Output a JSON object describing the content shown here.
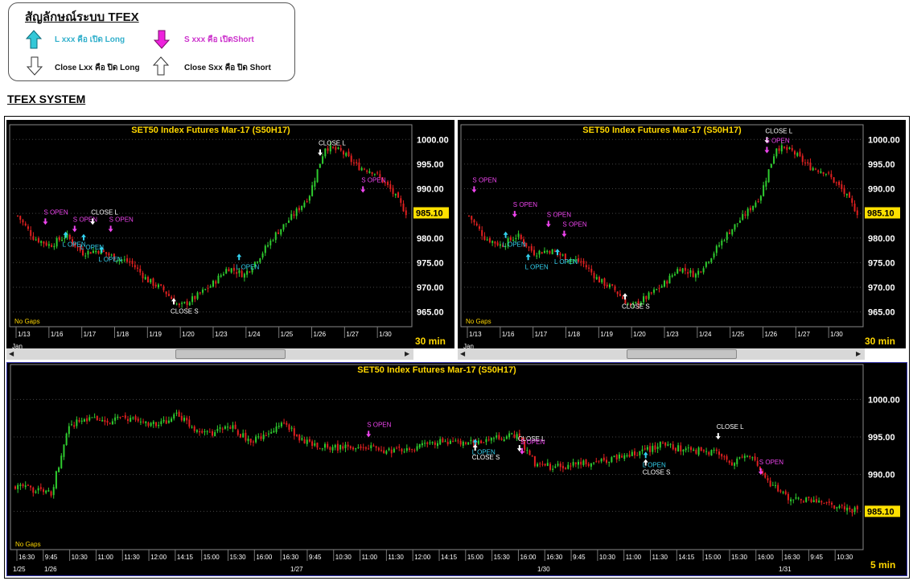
{
  "legend": {
    "title": "สัญลักษณ์ระบบ TFEX",
    "items": [
      {
        "label": "L xxx คือ เปิด Long",
        "color": "#33b0cc"
      },
      {
        "label": "S xxx คือ เปิดShort",
        "color": "#cc33cc"
      },
      {
        "label": "Close Lxx คือ ปิด Long",
        "color": "#111111"
      },
      {
        "label": "Close Sxx คือ ปิด Short",
        "color": "#111111"
      }
    ]
  },
  "system_title": "TFEX SYSTEM",
  "colors": {
    "up": "#2fcc2f",
    "down": "#e02020",
    "long": "#33d0ee",
    "short": "#ee44ee",
    "close": "#ffffff",
    "title": "#ffd700",
    "price_bg": "#ffe000"
  },
  "panels": [
    {
      "title": "SET50  Index  Futures  Mar-17  (S50H17)",
      "timeframe": "30  min",
      "no_gaps": "No  Gaps",
      "price_tag": "985.10",
      "y_ticks": [
        "1000.00",
        "995.00",
        "990.00",
        "985.00",
        "980.00",
        "975.00",
        "970.00",
        "965.00"
      ],
      "x_ticks": [
        "1/13",
        "1/16",
        "1/17",
        "1/18",
        "1/19",
        "1/20",
        "1/23",
        "1/24",
        "1/25",
        "1/26",
        "1/27",
        "1/30"
      ],
      "month_label": "Jan"
    },
    {
      "title": "SET50  Index  Futures  Mar-17  (S50H17)",
      "timeframe": "30  min",
      "no_gaps": "No  Gaps",
      "price_tag": "985.10",
      "y_ticks": [
        "1000.00",
        "995.00",
        "990.00",
        "985.00",
        "980.00",
        "975.00",
        "970.00",
        "965.00"
      ],
      "x_ticks": [
        "1/13",
        "1/16",
        "1/17",
        "1/18",
        "1/19",
        "1/20",
        "1/23",
        "1/24",
        "1/25",
        "1/26",
        "1/27",
        "1/30"
      ],
      "month_label": "Jan"
    },
    {
      "title": "SET50  Index  Futures  Mar-17  (S50H17)",
      "timeframe": "5  min",
      "no_gaps": "No  Gaps",
      "price_tag": "985.10",
      "y_ticks": [
        "1000.00",
        "995.00",
        "990.00",
        "985.10"
      ],
      "x_ticks": [
        "16:30",
        "9:45",
        "10:30",
        "11:00",
        "11:30",
        "12:00",
        "14:15",
        "15:00",
        "15:30",
        "16:00",
        "16:30",
        "9:45",
        "10:30",
        "11:00",
        "11:30",
        "12:00",
        "14:15",
        "15:00",
        "15:30",
        "16:00",
        "16:30",
        "9:45",
        "10:30",
        "11:00",
        "11:30",
        "14:15",
        "15:00",
        "15:30",
        "16:00",
        "16:30",
        "9:45",
        "10:30"
      ],
      "date_labels": [
        "1/25",
        "1/26",
        "1/27",
        "1/30",
        "1/31"
      ]
    }
  ],
  "chart_data": [
    {
      "type": "candlestick",
      "title": "SET50  Index  Futures  Mar-17  (S50H17)",
      "timeframe": "30 min",
      "ylim": [
        962,
        1002
      ],
      "dates": [
        "1/13",
        "1/16",
        "1/17",
        "1/18",
        "1/19",
        "1/20",
        "1/23",
        "1/24",
        "1/25",
        "1/26",
        "1/27",
        "1/30"
      ],
      "closes": [
        984.5,
        980,
        978.5,
        980.5,
        977,
        977.5,
        976,
        975,
        971.5,
        969.5,
        966,
        968,
        970.5,
        974,
        972.5,
        976.5,
        981,
        984.5,
        988.5,
        998.5,
        997.5,
        994.5,
        993.5,
        990,
        985.2
      ],
      "signals": [
        {
          "label": "S  OPEN",
          "kind": "short",
          "x": 1.3,
          "y": 983.5
        },
        {
          "label": "L  OPEN",
          "kind": "long",
          "x": 2.2,
          "y": 980.5
        },
        {
          "label": "S  OPEN",
          "kind": "short",
          "x": 2.6,
          "y": 982
        },
        {
          "label": "L  OPEN",
          "kind": "long",
          "x": 3.0,
          "y": 980
        },
        {
          "label": "CLOSE  L",
          "kind": "close",
          "x": 3.4,
          "y": 983.5
        },
        {
          "label": "L  OPEN",
          "kind": "long",
          "x": 3.8,
          "y": 977.5
        },
        {
          "label": "S  OPEN",
          "kind": "short",
          "x": 4.2,
          "y": 982
        },
        {
          "label": "CLOSE  S",
          "kind": "close",
          "x": 7.0,
          "y": 967
        },
        {
          "label": "L  OPEN",
          "kind": "long",
          "x": 9.9,
          "y": 976
        },
        {
          "label": "CLOSE  L",
          "kind": "close",
          "x": 13.5,
          "y": 997.5
        },
        {
          "label": "S  OPEN",
          "kind": "short",
          "x": 15.4,
          "y": 990
        }
      ],
      "last_price": 985.1
    },
    {
      "type": "candlestick",
      "title": "SET50  Index  Futures  Mar-17  (S50H17)",
      "timeframe": "30 min",
      "ylim": [
        962,
        1002
      ],
      "dates": [
        "1/13",
        "1/16",
        "1/17",
        "1/18",
        "1/19",
        "1/20",
        "1/23",
        "1/24",
        "1/25",
        "1/26",
        "1/27",
        "1/30"
      ],
      "closes": [
        984.5,
        980,
        978.5,
        980.5,
        977,
        977.5,
        976,
        975,
        971.5,
        969.5,
        966,
        968,
        970.5,
        974,
        972.5,
        976.5,
        981,
        984.5,
        988.5,
        998.5,
        997.5,
        994.5,
        993.5,
        990,
        985.2
      ],
      "signals": [
        {
          "label": "S  OPEN",
          "kind": "short",
          "x": 0.3,
          "y": 990
        },
        {
          "label": "L  OPEN",
          "kind": "long",
          "x": 1.7,
          "y": 980.5
        },
        {
          "label": "S  OPEN",
          "kind": "short",
          "x": 2.1,
          "y": 985
        },
        {
          "label": "L  OPEN",
          "kind": "long",
          "x": 2.7,
          "y": 976
        },
        {
          "label": "S  OPEN",
          "kind": "short",
          "x": 3.6,
          "y": 983
        },
        {
          "label": "L  OPEN",
          "kind": "long",
          "x": 4.0,
          "y": 977
        },
        {
          "label": "S  OPEN",
          "kind": "short",
          "x": 4.3,
          "y": 981
        },
        {
          "label": "CLOSE  S",
          "kind": "close",
          "x": 7.0,
          "y": 968
        },
        {
          "label": "CLOSE  L",
          "kind": "close",
          "x": 13.3,
          "y": 1000
        },
        {
          "label": "S  OPEN",
          "kind": "short",
          "x": 13.3,
          "y": 998
        }
      ],
      "last_price": 985.1
    },
    {
      "type": "candlestick",
      "title": "SET50  Index  Futures  Mar-17  (S50H17)",
      "timeframe": "5 min",
      "ylim": [
        980,
        1004
      ],
      "dates": [
        "1/25",
        "1/26",
        "1/27",
        "1/30",
        "1/31"
      ],
      "signals": [
        {
          "label": "S  OPEN",
          "kind": "short",
          "x": 0.42,
          "y": 995.5
        },
        {
          "label": "L  OPEN",
          "kind": "long",
          "x": 0.545,
          "y": 994.2
        },
        {
          "label": "CLOSE  S",
          "kind": "close",
          "x": 0.545,
          "y": 993.5
        },
        {
          "label": "CLOSE  L",
          "kind": "close",
          "x": 0.597,
          "y": 993.6
        },
        {
          "label": "S  OPEN",
          "kind": "short",
          "x": 0.6,
          "y": 993.2
        },
        {
          "label": "L  OPEN",
          "kind": "long",
          "x": 0.745,
          "y": 992.5
        },
        {
          "label": "CLOSE  S",
          "kind": "close",
          "x": 0.745,
          "y": 991.5
        },
        {
          "label": "CLOSE  L",
          "kind": "close",
          "x": 0.83,
          "y": 995.2
        },
        {
          "label": "S  OPEN",
          "kind": "short",
          "x": 0.88,
          "y": 990.5
        }
      ],
      "last_price": 985.1
    }
  ]
}
